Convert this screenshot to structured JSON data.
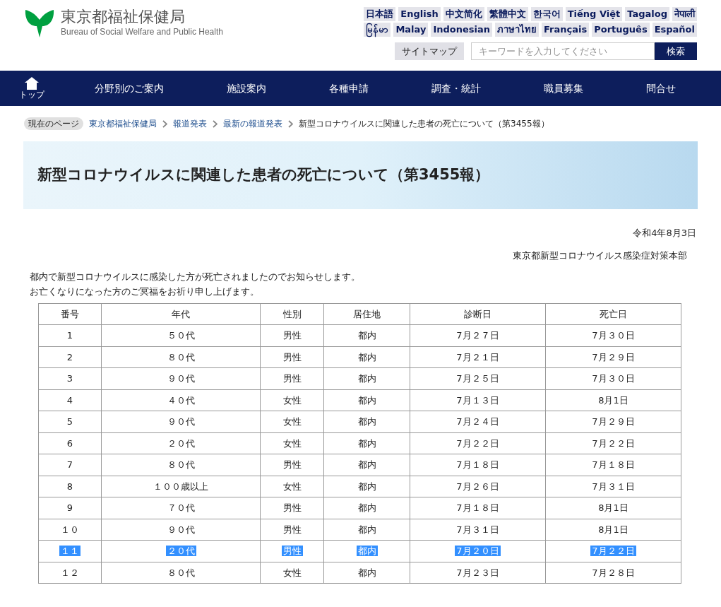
{
  "site": {
    "title": "東京都福祉保健局",
    "subtitle": "Bureau of Social Welfare and Public Health"
  },
  "languages": [
    [
      "日本語",
      "English",
      "中文简化",
      "繁體中文",
      "한국어",
      "Tiếng Việt",
      "Tagalog",
      "नेपाली"
    ],
    [
      "မြန်မာ",
      "Malay",
      "Indonesian",
      "ภาษาไทย",
      "Français",
      "Português",
      "Español"
    ]
  ],
  "sitemap": "サイトマップ",
  "search": {
    "placeholder": "キーワードを入力してください",
    "button": "検索"
  },
  "nav": {
    "home": "トップ",
    "items": [
      "分野別のご案内",
      "施設案内",
      "各種申請",
      "調査・統計",
      "職員募集",
      "問合せ"
    ]
  },
  "breadcrumb": {
    "label": "現在のページ",
    "links": [
      "東京都福祉保健局",
      "報道発表",
      "最新の報道発表"
    ],
    "current": "新型コロナウイルスに関連した患者の死亡について（第3455報）"
  },
  "heading": "新型コロナウイルスに関連した患者の死亡について（第3455報）",
  "date": "令和4年8月3日",
  "issuer": "東京都新型コロナウイルス感染症対策本部",
  "paragraphs": [
    "都内で新型コロナウイルスに感染した方が死亡されましたのでお知らせします。",
    "お亡くなりになった方のご冥福をお祈り申し上げます。"
  ],
  "table": {
    "columns": [
      "番号",
      "年代",
      "性別",
      "居住地",
      "診断日",
      "死亡日"
    ],
    "rows": [
      {
        "cells": [
          "1",
          "５０代",
          "男性",
          "都内",
          "7月２７日",
          "7月３０日"
        ],
        "selected": false
      },
      {
        "cells": [
          "2",
          "８０代",
          "男性",
          "都内",
          "7月２１日",
          "7月２９日"
        ],
        "selected": false
      },
      {
        "cells": [
          "3",
          "９０代",
          "男性",
          "都内",
          "7月２５日",
          "7月３０日"
        ],
        "selected": false
      },
      {
        "cells": [
          "4",
          "４０代",
          "女性",
          "都内",
          "7月１３日",
          "8月1日"
        ],
        "selected": false
      },
      {
        "cells": [
          "5",
          "９０代",
          "女性",
          "都内",
          "7月２４日",
          "7月２９日"
        ],
        "selected": false
      },
      {
        "cells": [
          "6",
          "２０代",
          "女性",
          "都内",
          "7月２２日",
          "7月２２日"
        ],
        "selected": false
      },
      {
        "cells": [
          "7",
          "８０代",
          "男性",
          "都内",
          "7月１８日",
          "7月１８日"
        ],
        "selected": false
      },
      {
        "cells": [
          "8",
          "１００歳以上",
          "女性",
          "都内",
          "7月２６日",
          "7月３１日"
        ],
        "selected": false
      },
      {
        "cells": [
          "9",
          "７０代",
          "男性",
          "都内",
          "7月１８日",
          "8月1日"
        ],
        "selected": false
      },
      {
        "cells": [
          "１０",
          "９０代",
          "男性",
          "都内",
          "7月３１日",
          "8月1日"
        ],
        "selected": false
      },
      {
        "cells": [
          "１１",
          "２０代",
          "男性",
          "都内",
          "7月２０日",
          "7月２２日"
        ],
        "selected": true
      },
      {
        "cells": [
          "１２",
          "８０代",
          "女性",
          "都内",
          "7月２３日",
          "7月２８日"
        ],
        "selected": false
      }
    ]
  }
}
